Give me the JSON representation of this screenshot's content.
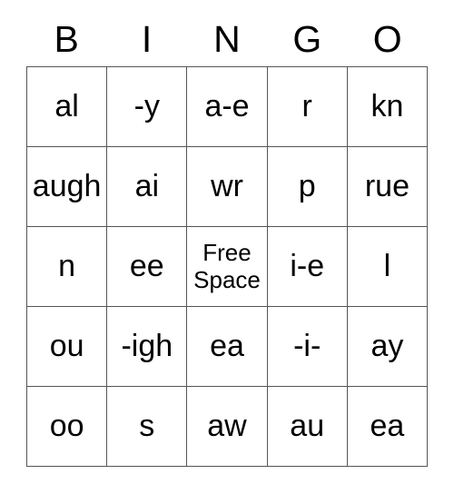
{
  "card": {
    "type": "bingo-card",
    "columns": 5,
    "rows": 5,
    "headers": [
      "B",
      "I",
      "N",
      "G",
      "O"
    ],
    "border_color": "#555555",
    "background_color": "#ffffff",
    "text_color": "#000000",
    "free_space_label": "Free Space",
    "cells": [
      [
        "al",
        "-y",
        "a-e",
        "r",
        "kn"
      ],
      [
        "augh",
        "ai",
        "wr",
        "p",
        "rue"
      ],
      [
        "n",
        "ee",
        "Free Space",
        "i-e",
        "l"
      ],
      [
        "ou",
        "-igh",
        "ea",
        "-i-",
        "ay"
      ],
      [
        "oo",
        "s",
        "aw",
        "au",
        "ea"
      ]
    ]
  }
}
